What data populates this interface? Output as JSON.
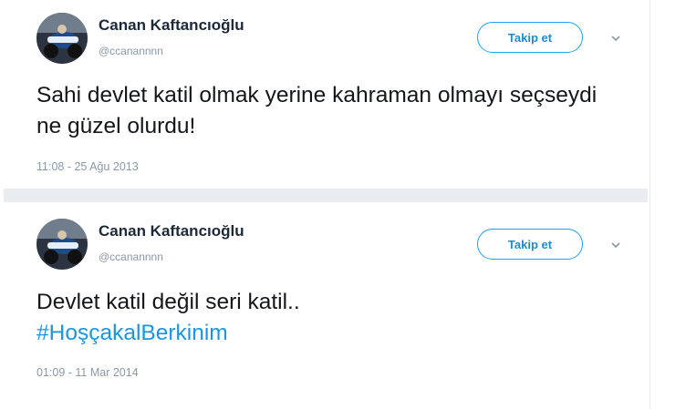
{
  "tweets": [
    {
      "display_name": "Canan Kaftancıoğlu",
      "handle": "@ccanannnn",
      "follow_label": "Takip et",
      "text": "Sahi devlet katil olmak yerine kahraman olmayı seçseydi ne güzel olurdu!",
      "hashtag": "",
      "timestamp": "11:08 - 25 Ağu 2013"
    },
    {
      "display_name": "Canan Kaftancıoğlu",
      "handle": "@ccanannnn",
      "follow_label": "Takip et",
      "text": "Devlet katil değil seri katil..",
      "hashtag": "#HoşçakalBerkinim",
      "timestamp": "01:09 - 11 Mar 2014"
    }
  ],
  "icons": {
    "avatar": "avatar",
    "menu": "chevron-down-icon"
  },
  "colors": {
    "accent": "#1da1f2",
    "link": "#1b95e0",
    "muted": "#8899a6",
    "text": "#14171a"
  }
}
